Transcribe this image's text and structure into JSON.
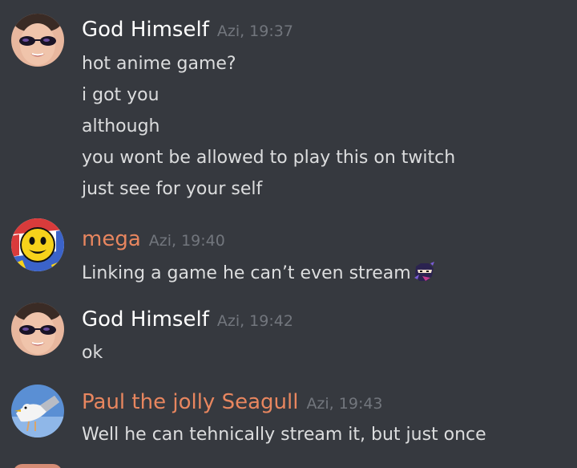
{
  "colors": {
    "background": "#36393f",
    "text": "#dcddde",
    "timestamp": "#72767d",
    "name_white": "#ffffff",
    "name_orange": "#e8865f"
  },
  "messages": [
    {
      "author": "God Himself",
      "timestamp": "Azi, 19:37",
      "avatar_icon": "user-photo-sunglasses-icon",
      "lines": [
        "hot anime game?",
        "i got you",
        "although",
        "you wont be allowed to play this on twitch",
        "just see for your self"
      ]
    },
    {
      "author": "mega",
      "timestamp": "Azi, 19:40",
      "avatar_icon": "pacman-avatar-icon",
      "lines": [
        "Linking a game he can’t even stream"
      ],
      "emote": "ninja-emote-icon"
    },
    {
      "author": "God Himself",
      "timestamp": "Azi, 19:42",
      "avatar_icon": "user-photo-sunglasses-icon",
      "lines": [
        "ok"
      ]
    },
    {
      "author": "Paul the jolly Seagull",
      "timestamp": "Azi, 19:43",
      "avatar_icon": "seagull-avatar-icon",
      "lines": [
        "Well he can tehnically stream it, but just once"
      ]
    }
  ]
}
